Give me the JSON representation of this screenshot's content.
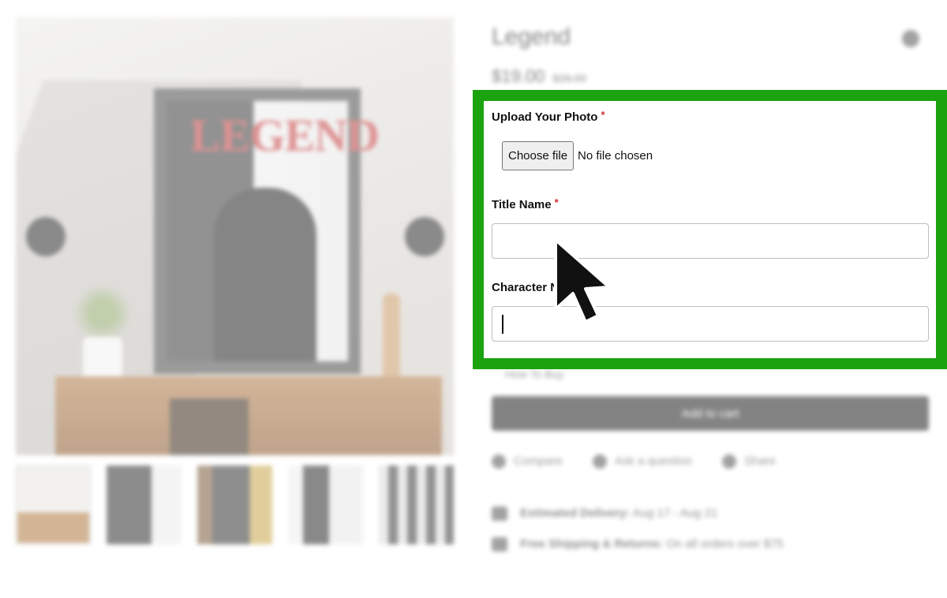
{
  "product": {
    "title": "Legend",
    "price": "$19.00",
    "old_price": "$26.00",
    "how_to_buy": "How To Buy",
    "add_to_cart": "Add to cart",
    "actions": [
      "Compare",
      "Ask a question",
      "Share"
    ],
    "delivery_label": "Estimated Delivery:",
    "delivery_value": "Aug 17 - Aug 21",
    "shipping_label": "Free Shipping & Returns:",
    "shipping_value": "On all orders over $75"
  },
  "gallery": {
    "poster_word": "LEGEND"
  },
  "form": {
    "upload_label": "Upload Your Photo",
    "choose_file": "Choose file",
    "no_file": "No file chosen",
    "title_label": "Title Name",
    "character_label": "Character N",
    "required_mark": "*"
  },
  "colors": {
    "highlight": "#1aa30f",
    "required": "#d0302a"
  },
  "icons": [
    "chevron-left-icon",
    "chevron-right-icon",
    "heart-icon",
    "compare-icon",
    "question-icon",
    "share-icon",
    "truck-icon",
    "globe-icon",
    "mouse-pointer-icon"
  ]
}
